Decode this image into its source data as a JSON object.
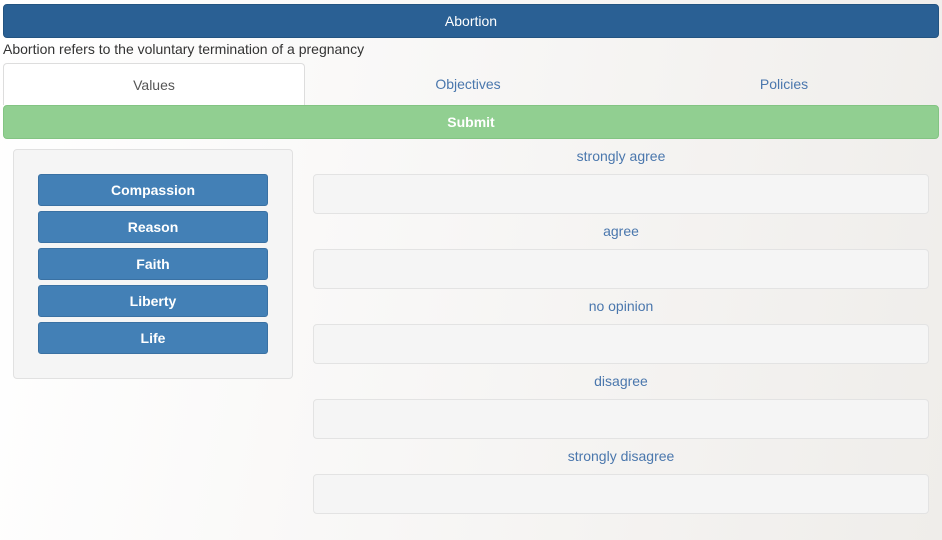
{
  "header": {
    "title": "Abortion"
  },
  "description": "Abortion refers to the voluntary termination of a pregnancy",
  "tabs": [
    {
      "label": "Values",
      "active": true
    },
    {
      "label": "Objectives",
      "active": false
    },
    {
      "label": "Policies",
      "active": false
    }
  ],
  "submit_label": "Submit",
  "values": [
    {
      "label": "Compassion"
    },
    {
      "label": "Reason"
    },
    {
      "label": "Faith"
    },
    {
      "label": "Liberty"
    },
    {
      "label": "Life"
    }
  ],
  "zones": [
    {
      "label": "strongly agree"
    },
    {
      "label": "agree"
    },
    {
      "label": "no opinion"
    },
    {
      "label": "disagree"
    },
    {
      "label": "strongly disagree"
    }
  ],
  "colors": {
    "header": "#2a6094",
    "submit": "#91cf91",
    "value_item": "#4380b6",
    "link": "#4a77ad"
  }
}
